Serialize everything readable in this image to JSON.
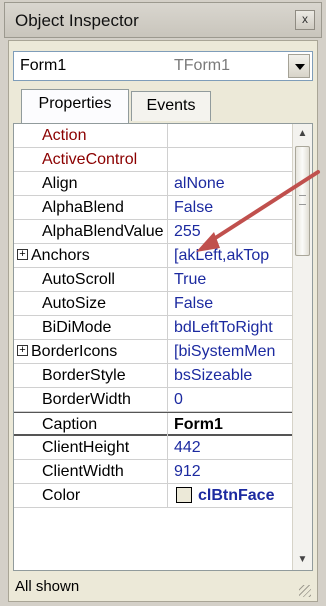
{
  "window": {
    "title": "Object Inspector",
    "close_label": "x"
  },
  "object_selector": {
    "name": "Form1",
    "class": "TForm1"
  },
  "tabs": [
    {
      "label": "Properties",
      "active": true
    },
    {
      "label": "Events",
      "active": false
    }
  ],
  "properties": [
    {
      "name": "Action",
      "value": "",
      "style": "red"
    },
    {
      "name": "ActiveControl",
      "value": "",
      "style": "red"
    },
    {
      "name": "Align",
      "value": "alNone"
    },
    {
      "name": "AlphaBlend",
      "value": "False"
    },
    {
      "name": "AlphaBlendValue",
      "value": "255"
    },
    {
      "name": "Anchors",
      "value": "[akLeft,akTop",
      "expandable": true
    },
    {
      "name": "AutoScroll",
      "value": "True"
    },
    {
      "name": "AutoSize",
      "value": "False"
    },
    {
      "name": "BiDiMode",
      "value": "bdLeftToRight"
    },
    {
      "name": "BorderIcons",
      "value": "[biSystemMen",
      "expandable": true
    },
    {
      "name": "BorderStyle",
      "value": "bsSizeable"
    },
    {
      "name": "BorderWidth",
      "value": "0"
    },
    {
      "name": "Caption",
      "value": "Form1",
      "selected": true
    },
    {
      "name": "ClientHeight",
      "value": "442"
    },
    {
      "name": "ClientWidth",
      "value": "912"
    },
    {
      "name": "Color",
      "value": "clBtnFace",
      "color_value": true
    }
  ],
  "status": {
    "text": "All shown"
  },
  "colors": {
    "annotation_arrow": "#c0504d",
    "value_text": "#1c2aa0",
    "red_property": "#8b0000"
  }
}
